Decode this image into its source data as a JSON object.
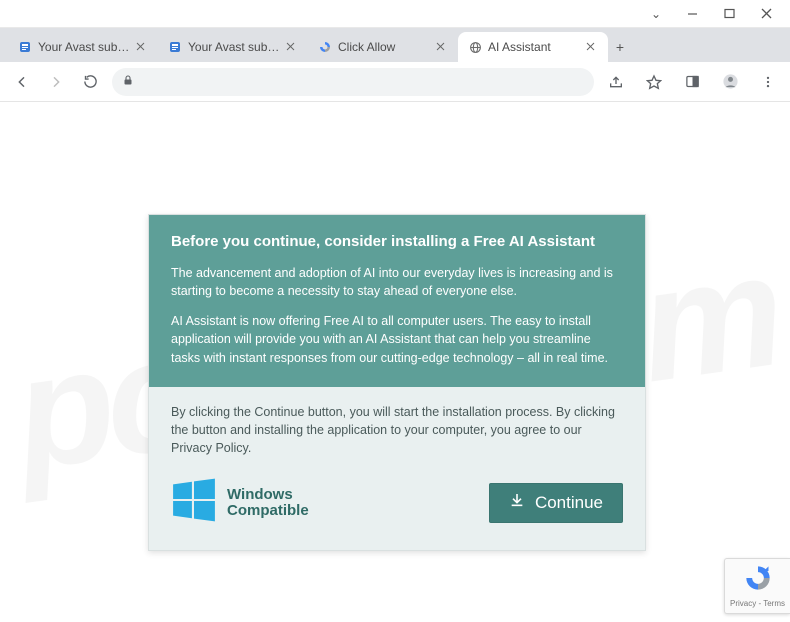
{
  "system": {
    "dropdown": "⌄"
  },
  "tabs": [
    {
      "title": "Your Avast subscription",
      "favicon": "doc-blue",
      "active": false
    },
    {
      "title": "Your Avast subscription",
      "favicon": "doc-blue",
      "active": false
    },
    {
      "title": "Click Allow",
      "favicon": "recaptcha",
      "active": false
    },
    {
      "title": "AI Assistant",
      "favicon": "globe",
      "active": true
    }
  ],
  "dialog": {
    "heading": "Before you continue, consider installing a Free AI Assistant",
    "para1": "The advancement and adoption of AI into our everyday lives is increasing and is starting to become a necessity to stay ahead of everyone else.",
    "para2": "AI Assistant is now offering Free AI to all computer users. The easy to install application will provide you with an AI Assistant that can help you streamline tasks with instant responses from our cutting-edge technology – all in real time.",
    "disclaimer": "By clicking the Continue button, you will start the installation process. By clicking the button and installing the application to your computer, you agree to our Privacy Policy.",
    "compat_line1": "Windows",
    "compat_line2": "Compatible",
    "continue_label": "Continue"
  },
  "recaptcha": {
    "legal": "Privacy - Terms"
  },
  "watermark": "pcrisk.com"
}
